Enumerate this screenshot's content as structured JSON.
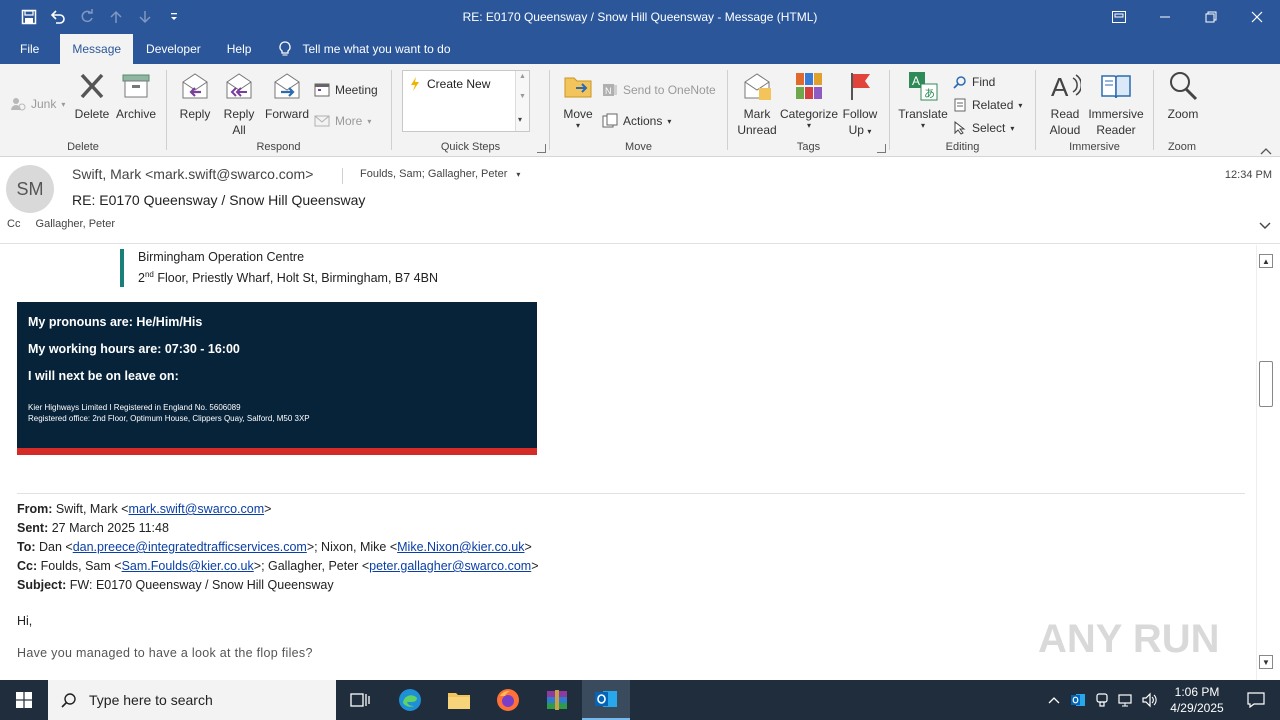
{
  "window": {
    "title": "RE: E0170 Queensway / Snow Hill Queensway  -  Message (HTML)"
  },
  "tabs": [
    {
      "label": "File"
    },
    {
      "label": "Message"
    },
    {
      "label": "Developer"
    },
    {
      "label": "Help"
    }
  ],
  "tell_me": "Tell me what you want to do",
  "ribbon": {
    "delete_group": {
      "label": "Delete",
      "junk": "Junk",
      "delete": "Delete",
      "archive": "Archive"
    },
    "respond_group": {
      "label": "Respond",
      "reply": "Reply",
      "reply_all_1": "Reply",
      "reply_all_2": "All",
      "forward": "Forward",
      "meeting": "Meeting",
      "more": "More"
    },
    "quick_steps_group": {
      "label": "Quick Steps",
      "create_new": "Create New"
    },
    "move_group": {
      "label": "Move",
      "move": "Move",
      "onenote": "Send to OneNote",
      "actions": "Actions"
    },
    "tags_group": {
      "label": "Tags",
      "mark_unread_1": "Mark",
      "mark_unread_2": "Unread",
      "categorize": "Categorize",
      "follow_up_1": "Follow",
      "follow_up_2": "Up"
    },
    "editing_group": {
      "label": "Editing",
      "translate": "Translate",
      "find": "Find",
      "related": "Related",
      "select": "Select"
    },
    "immersive_group": {
      "label": "Immersive",
      "read_aloud_1": "Read",
      "read_aloud_2": "Aloud",
      "immersive_reader_1": "Immersive",
      "immersive_reader_2": "Reader"
    },
    "zoom_group": {
      "label": "Zoom",
      "zoom": "Zoom"
    }
  },
  "message": {
    "avatar_initials": "SM",
    "sender": "Swift, Mark <mark.swift@swarco.com>",
    "recipients": "Foulds, Sam; Gallagher, Peter",
    "time": "12:34 PM",
    "subject": "RE: E0170 Queensway / Snow Hill Queensway",
    "cc_label": "Cc",
    "cc_value": "Gallagher, Peter"
  },
  "body": {
    "address_line1": "Birmingham Operation Centre",
    "address_line2_pre": "2",
    "address_line2_sup": "nd",
    "address_line2_post": " Floor, Priestly Wharf, Holt St, Birmingham, B7 4BN",
    "banner": {
      "pronouns": "My pronouns are:  He/Him/His",
      "hours": "My working hours are: 07:30  - 16:00",
      "leave": "I will next be on leave on:",
      "legal1": "Kier Highways Limited I Registered in England No. 5606089",
      "legal2": "Registered office: 2nd Floor, Optimum House, Clippers Quay, Salford, M50 3XP"
    },
    "fwd": {
      "from_label": "From:",
      "from_name": " Swift, Mark <",
      "from_email": "mark.swift@swarco.com",
      "from_close": ">",
      "sent_label": "Sent:",
      "sent_value": " 27 March 2025 11:48",
      "to_label": "To:",
      "to_name1": " Dan <",
      "to_email1": "dan.preece@integratedtrafficservices.com",
      "to_mid": ">; Nixon, Mike <",
      "to_email2": "Mike.Nixon@kier.co.uk",
      "to_close": ">",
      "cc_label": "Cc:",
      "cc_name1": " Foulds, Sam <",
      "cc_email1": "Sam.Foulds@kier.co.uk",
      "cc_mid": ">; Gallagher, Peter <",
      "cc_email2": "peter.gallagher@swarco.com",
      "cc_close": ">",
      "subject_label": "Subject:",
      "subject_value": " FW: E0170  Queensway / Snow Hill Queensway"
    },
    "greeting": "Hi,",
    "question": "Have you managed to have a look at the flop files?"
  },
  "watermark": "ANY RUN",
  "taskbar": {
    "search_placeholder": "Type here to search",
    "time": "1:06 PM",
    "date": "4/29/2025"
  }
}
